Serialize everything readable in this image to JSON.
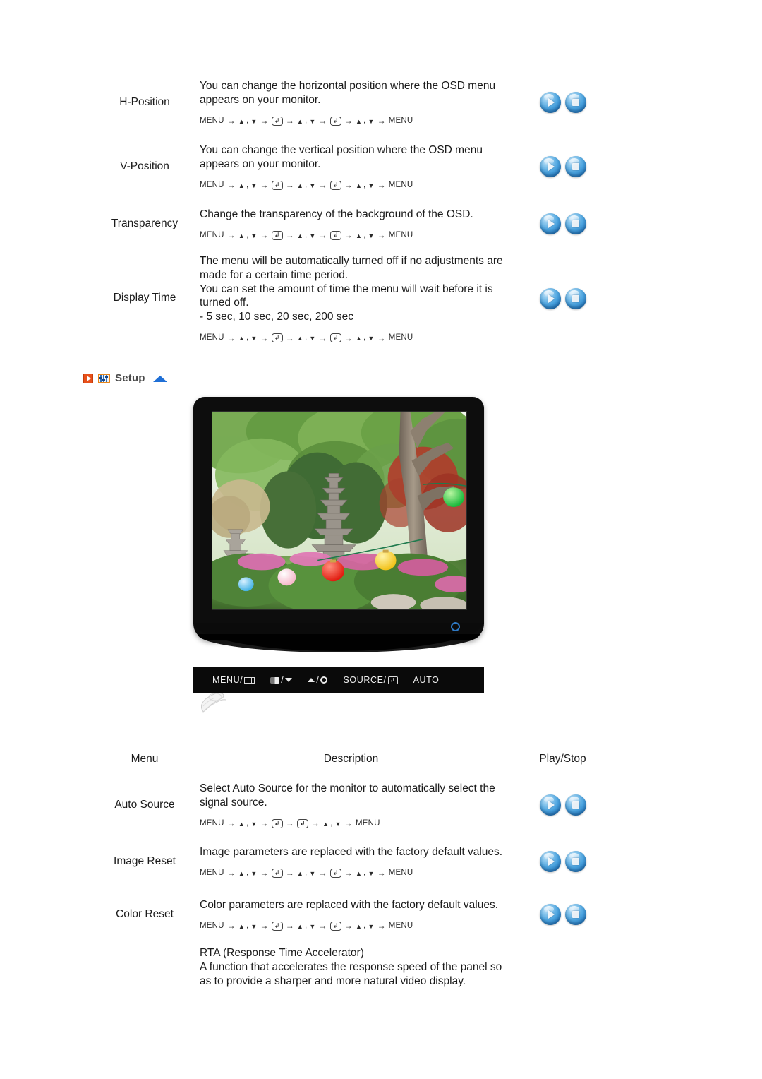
{
  "page": {
    "background": "#ffffff"
  },
  "osd_table": {
    "rows": [
      {
        "menu": "H-Position",
        "description": "You can change the horizontal position where the OSD menu\nappears on your monitor.",
        "path": "MENU → ▲,▼ → ⏎ → ▲,▼ → ⏎ → ▲,▼ → MENU",
        "path_long": true,
        "play_label": "Play",
        "stop_label": "Stop"
      },
      {
        "menu": "V-Position",
        "description": "You can change the vertical position where the OSD menu\nappears on your monitor.",
        "path": "MENU → ▲,▼ → ⏎ → ▲,▼ → ⏎ → ▲,▼ → MENU",
        "path_long": true,
        "play_label": "Play",
        "stop_label": "Stop"
      },
      {
        "menu": "Transparency",
        "description": "Change the transparency of the background of the OSD.",
        "path": "MENU → ▲,▼ → ⏎ → ▲,▼ → ⏎ → ▲,▼ → MENU",
        "path_long": true,
        "play_label": "Play",
        "stop_label": "Stop"
      },
      {
        "menu": "Display Time",
        "description": "The menu will be automatically turned off if no adjustments are\nmade for a certain time period.\nYou can set the amount of time the menu will wait before it is\nturned off.\n- 5 sec, 10 sec, 20 sec, 200 sec",
        "path": "MENU → ▲,▼ → ⏎ → ▲,▼ → ⏎ → ▲,▼ → MENU",
        "path_long": true,
        "play_label": "Play",
        "stop_label": "Stop"
      }
    ]
  },
  "setup_section": {
    "heading": "Setup",
    "play_icon_name": "play-square-icon",
    "setup_icon_name": "setup-sliders-icon",
    "collapse_icon_name": "triangle-up-icon",
    "heading_color": "#4b4b4b",
    "accent_orange": "#e8501a",
    "accent_blue": "#1f6fd6"
  },
  "monitor": {
    "screen_alt": "Garden scene with stone pagoda, trees and colored paper lanterns",
    "power_led_color": "#2e79c4",
    "control_bar": {
      "buttons": [
        {
          "label": "MENU/",
          "icon": "osd-menu-icon"
        },
        {
          "label": "/",
          "icon_left": "brightness-half-icon",
          "icon_right": "triangle-down-icon"
        },
        {
          "label": "/",
          "icon_left": "triangle-up-icon",
          "icon_right": "brightness-sun-icon"
        },
        {
          "label": "SOURCE/",
          "icon": "enter-key-icon"
        },
        {
          "label": "AUTO",
          "icon": ""
        }
      ]
    },
    "cursor_icon": "hand-pointer-icon"
  },
  "setup_table": {
    "headers": {
      "menu": "Menu",
      "description": "Description",
      "play_stop": "Play/Stop"
    },
    "rows": [
      {
        "menu": "Auto Source",
        "description": "Select Auto Source for the monitor to automatically select the\nsignal source.",
        "path": "MENU → ▲,▼ → ⏎ → ⏎ → ▲,▼ → MENU",
        "path_long": false,
        "play_label": "Play",
        "stop_label": "Stop"
      },
      {
        "menu": "Image Reset",
        "description": "Image parameters are replaced with the factory default values.",
        "path": "MENU → ▲,▼ → ⏎ → ▲,▼ → ⏎ → ▲,▼ → MENU",
        "path_long": true,
        "play_label": "Play",
        "stop_label": "Stop"
      },
      {
        "menu": "Color Reset",
        "description": "Color parameters are replaced with the factory default values.",
        "path": "MENU → ▲,▼ → ⏎ → ▲,▼ → ⏎ → ▲,▼ → MENU",
        "path_long": true,
        "play_label": "Play",
        "stop_label": "Stop"
      },
      {
        "menu": "",
        "description": "RTA (Response Time Accelerator)\nA function that accelerates the response speed of the panel so\nas to provide a sharper and more natural video display.",
        "path": "",
        "path_long": false,
        "play_label": "",
        "stop_label": ""
      }
    ]
  },
  "glyphs": {
    "menu_word": "MENU",
    "arrow": "→",
    "tri_up": "▲",
    "tri_down": "▼",
    "comma": ",",
    "enter": "⏎"
  }
}
